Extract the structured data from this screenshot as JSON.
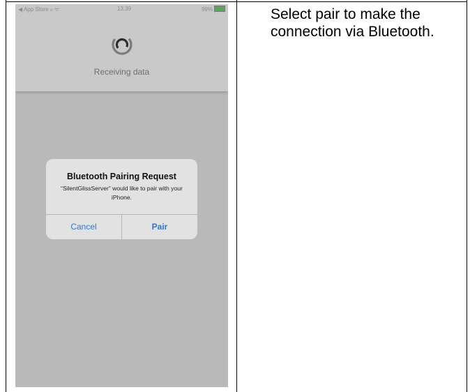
{
  "status_bar": {
    "back_app": "◀ App Store",
    "signal": "ᵢₗₗ ᯤ",
    "time": "13:39",
    "battery": "99%"
  },
  "header": {
    "status_text": "Receiving data",
    "spinner_icon": "loading-spinner-icon"
  },
  "dialog": {
    "title": "Bluetooth Pairing Request",
    "message": "“SilentGlissServer” would like to pair with your iPhone.",
    "cancel_label": "Cancel",
    "pair_label": "Pair"
  },
  "instruction": {
    "text": "Select pair to make the connection via Bluetooth."
  },
  "colors": {
    "header_bg": "#c9c9c9",
    "overlay_bg": "#b9b9b9",
    "dialog_bg": "#e2e2e2",
    "accent": "#2a77d8"
  }
}
